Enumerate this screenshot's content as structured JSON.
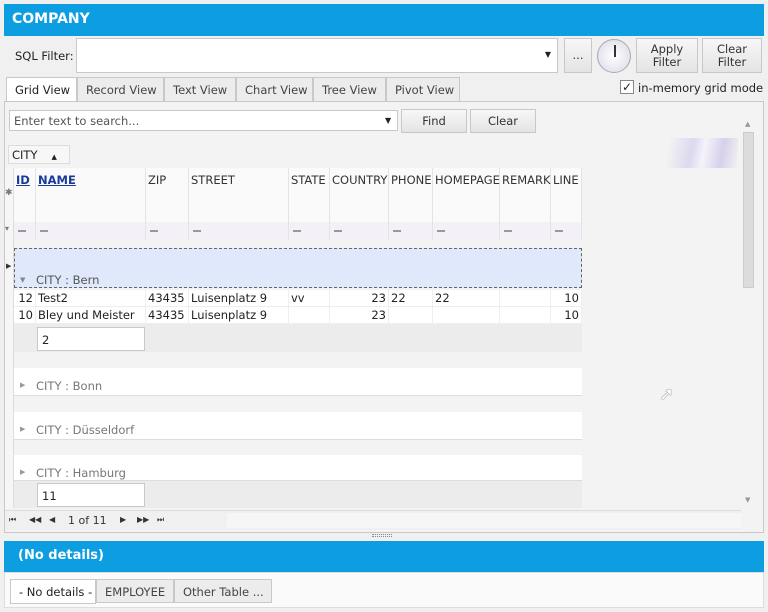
{
  "title": "COMPANY",
  "toolbar": {
    "sql_label": "SQL Filter:",
    "sql_value": "",
    "ellipsis": "...",
    "apply": "Apply Filter",
    "clear": "Clear Filter"
  },
  "tabs": [
    "Grid View",
    "Record View",
    "Text View",
    "Chart View",
    "Tree View",
    "Pivot View"
  ],
  "in_memory": {
    "label": "in-memory grid mode",
    "checked": true
  },
  "search": {
    "placeholder": "Enter text to search...",
    "find": "Find",
    "clear": "Clear"
  },
  "group_panel": {
    "column": "CITY"
  },
  "columns": [
    "ID",
    "NAME",
    "ZIP",
    "STREET",
    "STATE",
    "COUNTRY",
    "PHONE",
    "HOMEPAGE",
    "REMARK",
    "LINE"
  ],
  "groups": [
    {
      "label": "CITY : Bern",
      "expanded": true,
      "rows": [
        [
          "12",
          "Test2",
          "43435",
          "Luisenplatz 9",
          "vv",
          "23",
          "22",
          "22",
          "",
          "10"
        ],
        [
          "10",
          "Bley und Meister",
          "43435",
          "Luisenplatz 9",
          "",
          "23",
          "",
          "",
          "",
          "10"
        ]
      ],
      "footer": "2"
    },
    {
      "label": "CITY : Bonn",
      "expanded": false
    },
    {
      "label": "CITY : Düsseldorf",
      "expanded": false
    },
    {
      "label": "CITY : Hamburg",
      "expanded": false
    }
  ],
  "total_footer": "11",
  "navigator": {
    "position": "1 of 11"
  },
  "details": {
    "title": "(No details)",
    "tabs": [
      "- No details -",
      "EMPLOYEE",
      "Other Table ..."
    ]
  }
}
